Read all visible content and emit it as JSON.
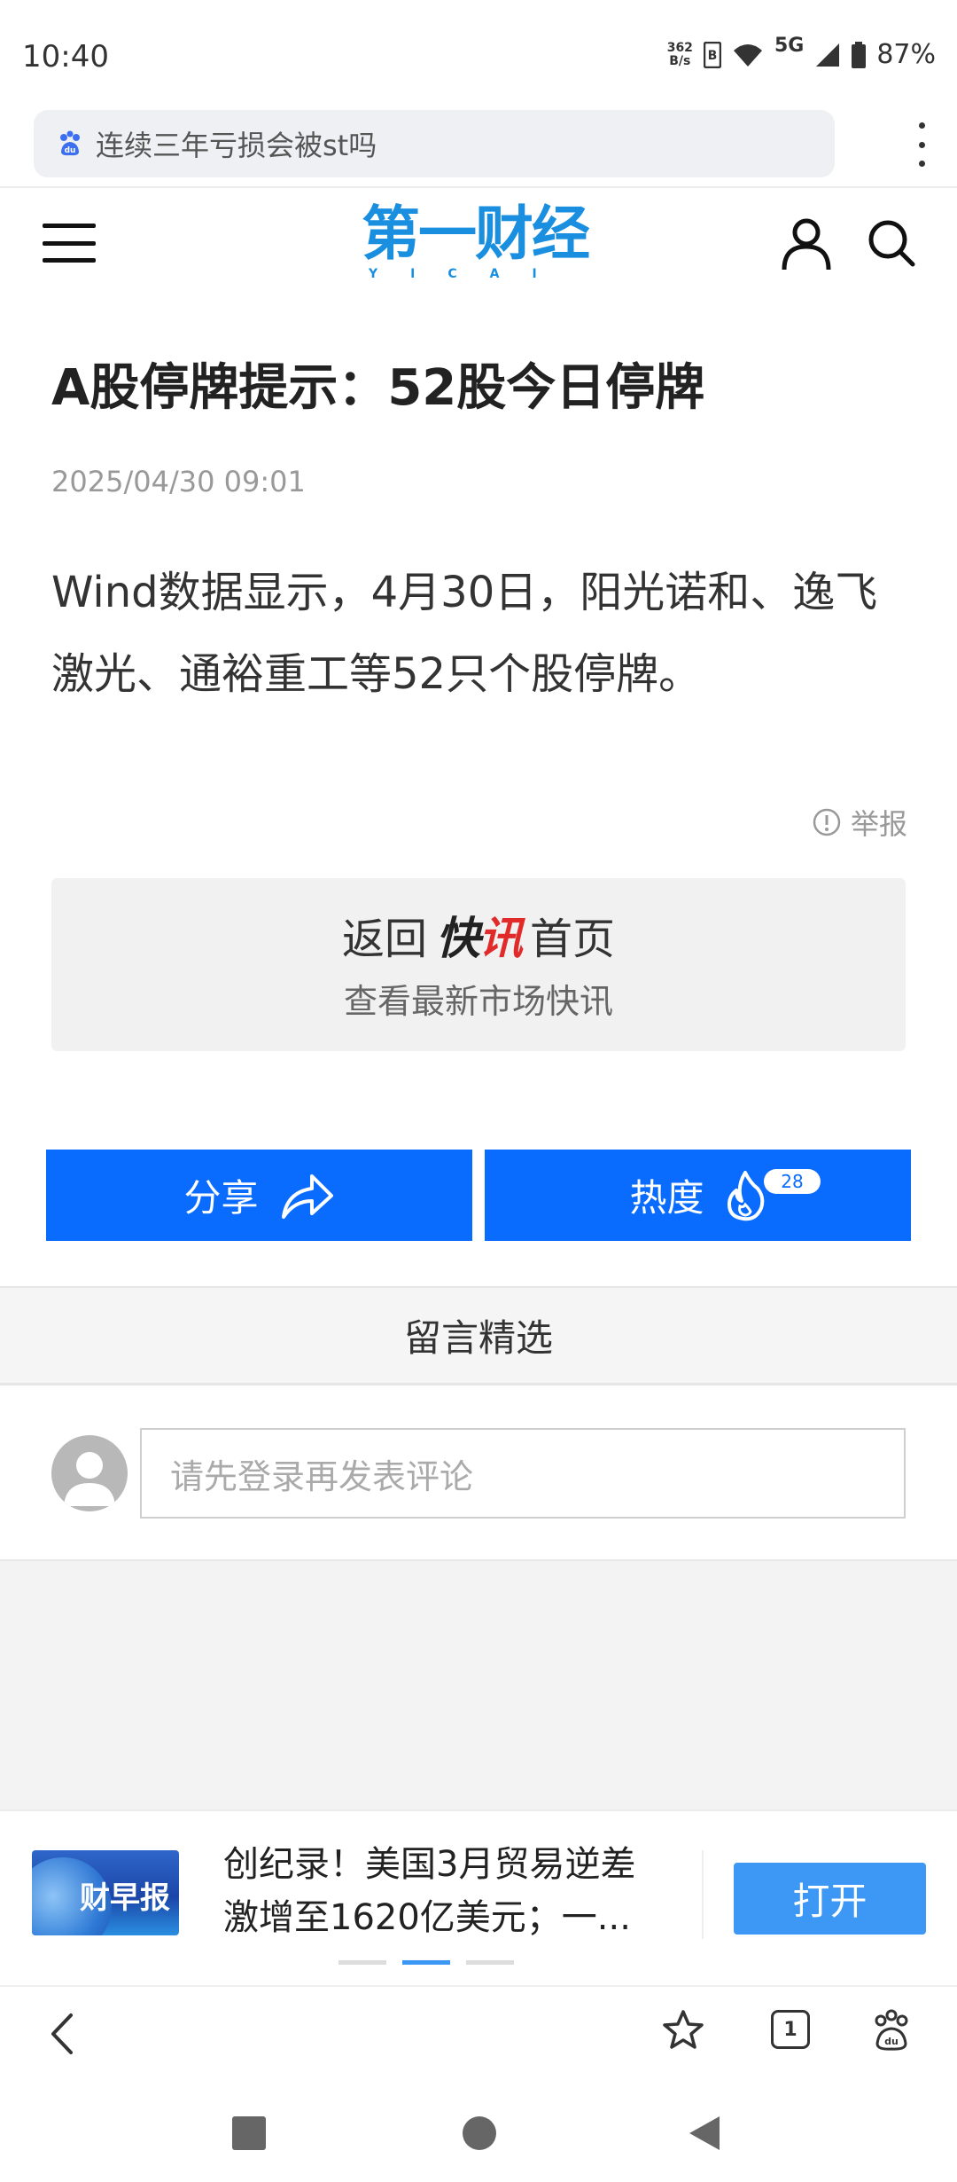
{
  "status_bar": {
    "time": "10:40",
    "net_speed_value": "362",
    "net_speed_unit": "B/s",
    "network": "5G",
    "battery": "87%"
  },
  "search_bar": {
    "query": "连续三年亏损会被st吗",
    "icon": "baidu-paw-icon"
  },
  "site_header": {
    "logo_main": "第一财经",
    "logo_sub": "YICAI",
    "icons": [
      "menu-icon",
      "user-icon",
      "search-icon"
    ]
  },
  "article": {
    "title": "A股停牌提示：52股今日停牌",
    "date": "2025/04/30 09:01",
    "body": "Wind数据显示，4月30日，阳光诺和、逸飞激光、通裕重工等52只个股停牌。",
    "report_label": "举报"
  },
  "return_box": {
    "prefix": "返回",
    "brand_a": "快",
    "brand_b": "讯",
    "suffix": "首页",
    "subtitle": "查看最新市场快讯"
  },
  "actions": {
    "share_label": "分享",
    "heat_label": "热度",
    "heat_count": "28"
  },
  "comments": {
    "section_title": "留言精选",
    "input_placeholder": "请先登录再发表评论"
  },
  "promo": {
    "logo_label": "财早报",
    "headline_line1": "创纪录！美国3月贸易逆差",
    "headline_line2": "激增至1620亿美元；一...",
    "open_label": "打开",
    "page_count": 3,
    "active_page": 2
  },
  "browser_nav": {
    "tab_count": "1"
  },
  "colors": {
    "accent_blue": "#0a6cff",
    "open_button": "#3d97f4",
    "logo_blue": "#1a8fe0",
    "brand_red": "#e12b2b"
  }
}
